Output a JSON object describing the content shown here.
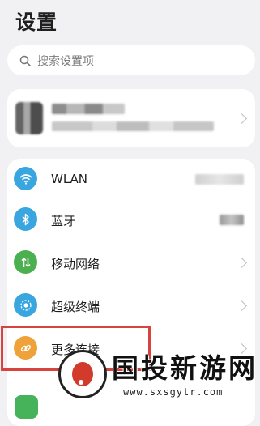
{
  "header": {
    "title": "设置"
  },
  "search": {
    "placeholder": "搜索设置项"
  },
  "settings": {
    "items": [
      {
        "label": "WLAN",
        "icon": "wifi-icon",
        "color": "#3aa6e0"
      },
      {
        "label": "蓝牙",
        "icon": "bluetooth-icon",
        "color": "#3aa6e0"
      },
      {
        "label": "移动网络",
        "icon": "mobile-network-icon",
        "color": "#4caf50"
      },
      {
        "label": "超级终端",
        "icon": "super-device-icon",
        "color": "#3aa6e0"
      },
      {
        "label": "更多连接",
        "icon": "link-icon",
        "color": "#f0a23a"
      }
    ]
  },
  "watermark": {
    "title": "国投新游网",
    "url": "www.sxsgytr.com"
  }
}
